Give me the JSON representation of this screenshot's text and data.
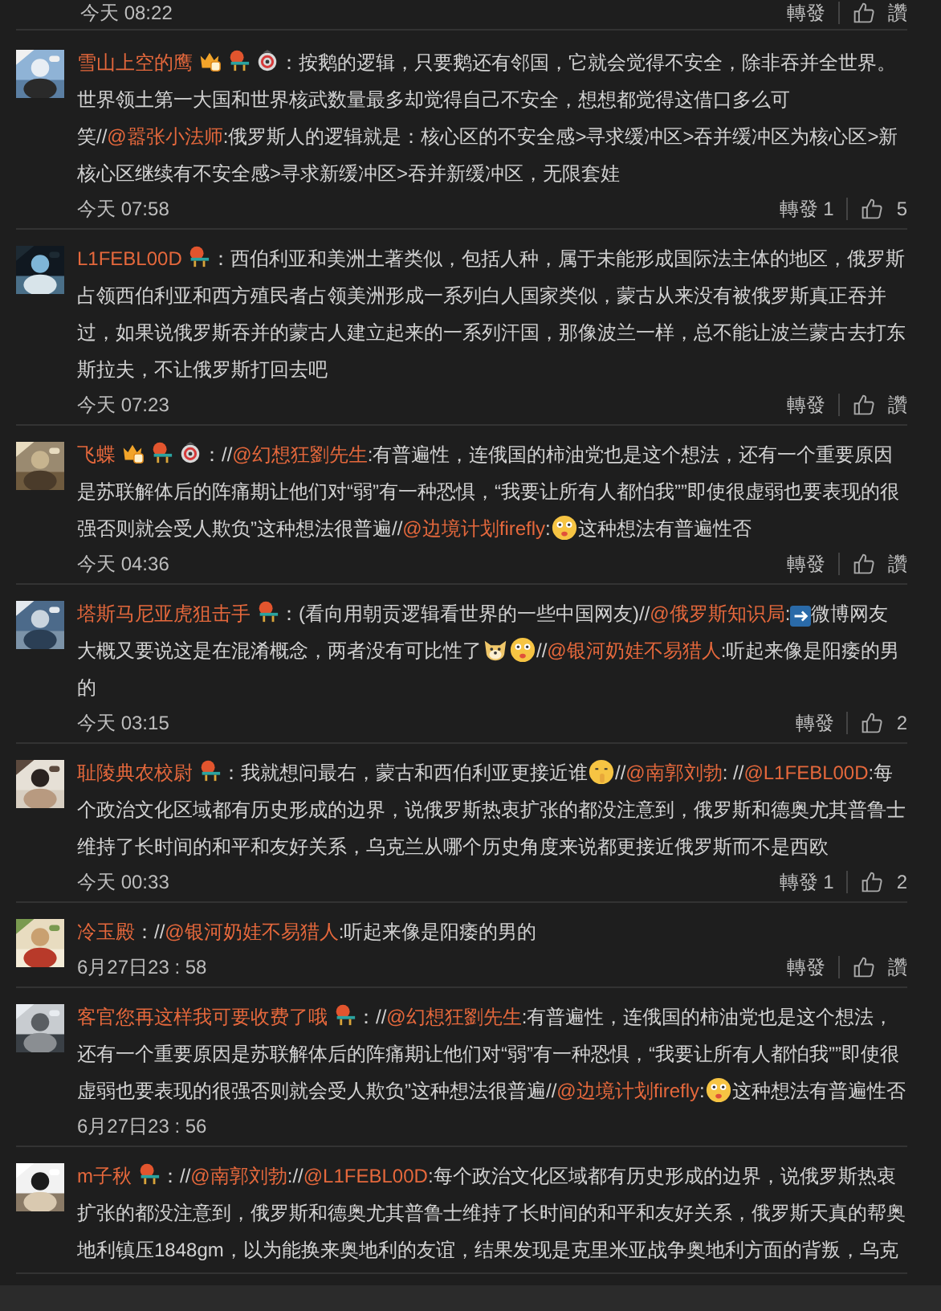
{
  "previous_footer": {
    "time": "今天 08:22",
    "repost": "轉發",
    "likes": "讚"
  },
  "comments": [
    {
      "name": "雪山上空的鹰",
      "badges": [
        {
          "kind": "vip"
        },
        {
          "kind": "fan"
        },
        {
          "kind": "eye"
        }
      ],
      "segments": [
        {
          "kind": "text",
          "text": "：按鹅的逻辑，只要鹅还有邻国，它就会觉得不安全，除非吞并全世界。世界领土第一大国和世界核武数量最多却觉得自己不安全，想想都觉得这借口多么可笑//"
        },
        {
          "kind": "mention",
          "text": "@嚣张小法师"
        },
        {
          "kind": "text",
          "text": ":俄罗斯人的逻辑就是：核心区的不安全感>寻求缓冲区>吞并缓冲区为核心区>新核心区继续有不安全感>寻求新缓冲区>吞并新缓冲区，无限套娃"
        }
      ],
      "time": "今天 07:58",
      "repost": "轉發 1",
      "likes": "5"
    },
    {
      "name": "L1FEBL00D",
      "badges": [
        {
          "kind": "fan"
        }
      ],
      "segments": [
        {
          "kind": "text",
          "text": "：西伯利亚和美洲土著类似，包括人种，属于未能形成国际法主体的地区，俄罗斯占领西伯利亚和西方殖民者占领美洲形成一系列白人国家类似，蒙古从来没有被俄罗斯真正吞并过，如果说俄罗斯吞并的蒙古人建立起来的一系列汗国，那像波兰一样，总不能让波兰蒙古去打东斯拉夫，不让俄罗斯打回去吧"
        }
      ],
      "time": "今天 07:23",
      "repost": "轉發",
      "likes": "讚"
    },
    {
      "name": "飞蝶",
      "badges": [
        {
          "kind": "vip"
        },
        {
          "kind": "fan"
        },
        {
          "kind": "eye"
        }
      ],
      "segments": [
        {
          "kind": "text",
          "text": "：//"
        },
        {
          "kind": "mention",
          "text": "@幻想狂劉先生"
        },
        {
          "kind": "text",
          "text": ":有普遍性，连俄国的柿油党也是这个想法，还有一个重要原因是苏联解体后的阵痛期让他们对“弱”有一种恐惧，“我要让所有人都怕我””即使很虚弱也要表现的很强否则就会受人欺负”这种想法很普遍//"
        },
        {
          "kind": "mention",
          "text": "@边境计划firefly"
        },
        {
          "kind": "text",
          "text": ":"
        },
        {
          "kind": "smile"
        },
        {
          "kind": "text",
          "text": "这种想法有普遍性否"
        }
      ],
      "time": "今天 04:36",
      "repost": "轉發",
      "likes": "讚"
    },
    {
      "name": "塔斯马尼亚虎狙击手",
      "badges": [
        {
          "kind": "fan"
        }
      ],
      "segments": [
        {
          "kind": "text",
          "text": "：(看向用朝贡逻辑看世界的一些中国网友)//"
        },
        {
          "kind": "mention",
          "text": "@俄罗斯知识局"
        },
        {
          "kind": "text",
          "text": ":"
        },
        {
          "kind": "arrow"
        },
        {
          "kind": "text",
          "text": "微博网友大概又要说这是在混淆概念，两者没有可比性了"
        },
        {
          "kind": "dog"
        },
        {
          "kind": "smile"
        },
        {
          "kind": "text",
          "text": "//"
        },
        {
          "kind": "mention",
          "text": "@银河奶娃不易猎人"
        },
        {
          "kind": "text",
          "text": ":听起来像是阳痿的男的"
        }
      ],
      "time": "今天 03:15",
      "repost": "轉發",
      "likes": "2"
    },
    {
      "name": "耻陵典农校尉",
      "badges": [
        {
          "kind": "fan"
        }
      ],
      "segments": [
        {
          "kind": "text",
          "text": "：我就想问最右，蒙古和西伯利亚更接近谁"
        },
        {
          "kind": "shush"
        },
        {
          "kind": "text",
          "text": "//"
        },
        {
          "kind": "mention",
          "text": "@南郭刘勃"
        },
        {
          "kind": "text",
          "text": ": //"
        },
        {
          "kind": "mention",
          "text": "@L1FEBL00D"
        },
        {
          "kind": "text",
          "text": ":每个政治文化区域都有历史形成的边界，说俄罗斯热衷扩张的都没注意到，俄罗斯和德奥尤其普鲁士维持了长时间的和平和友好关系，乌克兰从哪个历史角度来说都更接近俄罗斯而不是西欧"
        }
      ],
      "time": "今天 00:33",
      "repost": "轉發 1",
      "likes": "2"
    },
    {
      "name": "冷玉殿",
      "segments": [
        {
          "kind": "text",
          "text": "：//"
        },
        {
          "kind": "mention",
          "text": "@银河奶娃不易猎人"
        },
        {
          "kind": "text",
          "text": ":听起来像是阳痿的男的"
        }
      ],
      "time": "6月27日23 : 58",
      "repost": "轉發",
      "likes": "讚"
    },
    {
      "name": "客官您再这样我可要收费了哦",
      "badges": [
        {
          "kind": "fan"
        }
      ],
      "segments": [
        {
          "kind": "text",
          "text": "：//"
        },
        {
          "kind": "mention",
          "text": "@幻想狂劉先生"
        },
        {
          "kind": "text",
          "text": ":有普遍性，连俄国的柿油党也是这个想法，还有一个重要原因是苏联解体后的阵痛期让他们对“弱”有一种恐惧，“我要让所有人都怕我””即使很虚弱也要表现的很强否则就会受人欺负”这种想法很普遍//"
        },
        {
          "kind": "mention",
          "text": "@边境计划firefly"
        },
        {
          "kind": "text",
          "text": ":"
        },
        {
          "kind": "smile"
        },
        {
          "kind": "text",
          "text": "这种想法有普遍性否"
        }
      ],
      "time": "6月27日23 : 56"
    },
    {
      "name": "m子秋",
      "badges": [
        {
          "kind": "fan"
        }
      ],
      "segments": [
        {
          "kind": "text",
          "text": "：//"
        },
        {
          "kind": "mention",
          "text": "@南郭刘勃"
        },
        {
          "kind": "text",
          "text": "://"
        },
        {
          "kind": "mention",
          "text": "@L1FEBL00D"
        },
        {
          "kind": "text",
          "text": ":每个政治文化区域都有历史形成的边界，说俄罗斯热衷扩张的都没注意到，俄罗斯和德奥尤其普鲁士维持了长时间的和平和友好关系，俄罗斯天真的帮奥地利镇压1848gm，以为能换来奥地利的友谊，结果发现是克里米亚战争奥地利方面的背叛，乌克"
        }
      ]
    }
  ]
}
